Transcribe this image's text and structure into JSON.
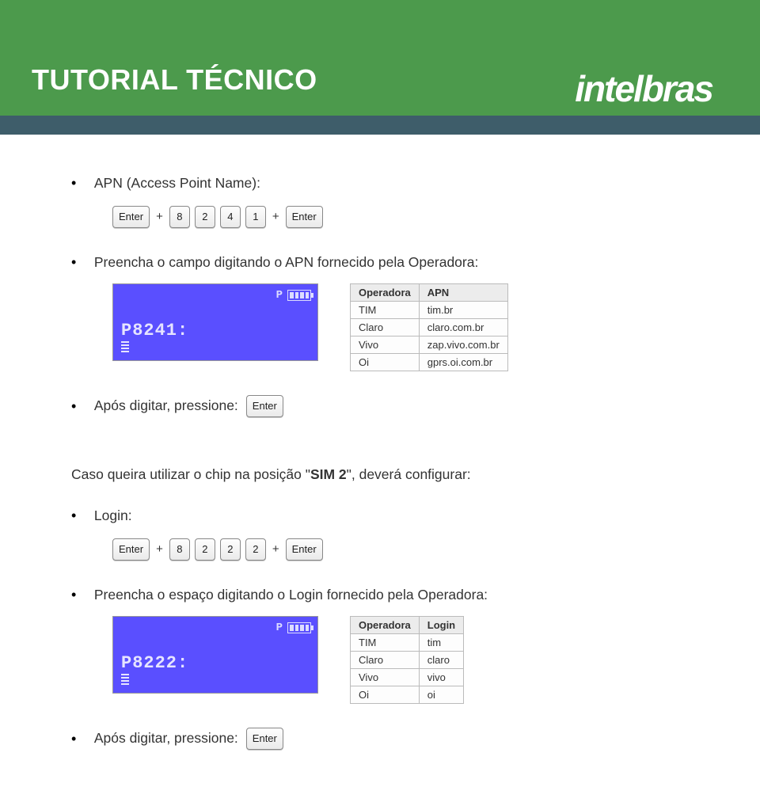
{
  "header": {
    "title": "TUTORIAL TÉCNICO",
    "brand": "intelbras"
  },
  "keys": {
    "enter": "Enter",
    "plus": "+",
    "k8": "8",
    "k2": "2",
    "k4": "4",
    "k1": "1"
  },
  "bullet_apn_title": "APN (Access Point Name):",
  "apn_keys": [
    "Enter",
    "8",
    "2",
    "4",
    "1",
    "Enter"
  ],
  "bullet_apn_fill": "Preencha o campo digitando o APN fornecido pela Operadora:",
  "lcd_apn": {
    "p_label": "P",
    "code": "P8241:"
  },
  "apn_table": {
    "headers": [
      "Operadora",
      "APN"
    ],
    "rows": [
      [
        "TIM",
        "tim.br"
      ],
      [
        "Claro",
        "claro.com.br"
      ],
      [
        "Vivo",
        "zap.vivo.com.br"
      ],
      [
        "Oi",
        "gprs.oi.com.br"
      ]
    ]
  },
  "after_type_press": "Após digitar, pressione:",
  "sim2_text_pre": "Caso queira utilizar o chip na posição \"",
  "sim2_bold": "SIM 2",
  "sim2_text_post": "\", deverá configurar:",
  "bullet_login_title": "Login:",
  "login_keys": [
    "Enter",
    "8",
    "2",
    "2",
    "2",
    "Enter"
  ],
  "bullet_login_fill": "Preencha o espaço digitando o Login fornecido pela Operadora:",
  "lcd_login": {
    "p_label": "P",
    "code": "P8222:"
  },
  "login_table": {
    "headers": [
      "Operadora",
      "Login"
    ],
    "rows": [
      [
        "TIM",
        "tim"
      ],
      [
        "Claro",
        "claro"
      ],
      [
        "Vivo",
        "vivo"
      ],
      [
        "Oi",
        "oi"
      ]
    ]
  },
  "after_type_press_2": "Após digitar, pressione:"
}
